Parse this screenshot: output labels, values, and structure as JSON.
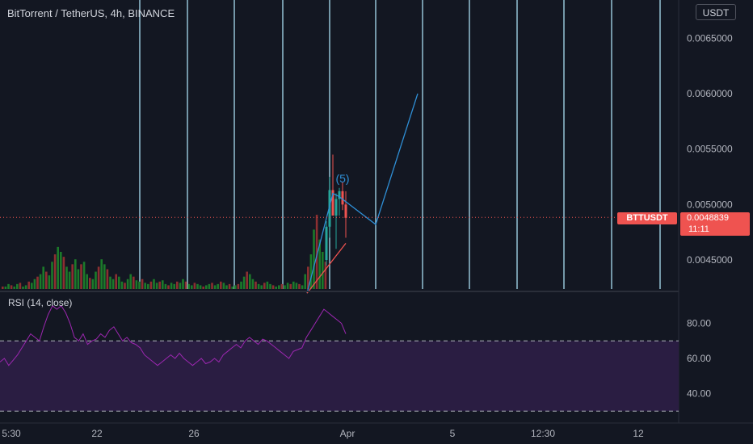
{
  "header": {
    "title": "BitTorrent / TetherUS, 4h, BINANCE",
    "currency": "USDT"
  },
  "price_label": {
    "symbol": "BTTUSDT",
    "price": "0.0048839",
    "countdown": "11:11"
  },
  "rsi": {
    "title": "RSI (14, close)"
  },
  "colors": {
    "background": "#131722",
    "up": "#26a69a",
    "down": "#ef5350",
    "volume_up": "#1b7a2a",
    "volume_down": "#8c2f31",
    "vline": "#a8dcf2",
    "projection": "#2f8fd6",
    "rsi_line": "#9c27b0",
    "rsi_band": "#2a1d42",
    "price_line": "#ef5350"
  },
  "chart_data": [
    {
      "type": "candlestick",
      "title": "BitTorrent / TetherUS, 4h, BINANCE",
      "ylim": [
        0.0042,
        0.0068
      ],
      "y_ticks": [
        "0.0045000",
        "0.0050000",
        "0.0055000",
        "0.0060000",
        "0.0065000"
      ],
      "x_ticks": [
        "5:30",
        "22",
        "26",
        "Apr",
        "5",
        "12:30",
        "12"
      ],
      "last_price": 0.0048839,
      "wave_label": "(5)",
      "candles": [
        {
          "x": 404,
          "open": 0.0045,
          "high": 0.00485,
          "low": 0.00445,
          "close": 0.0048
        },
        {
          "x": 408,
          "open": 0.0048,
          "high": 0.00525,
          "low": 0.0047,
          "close": 0.00513
        },
        {
          "x": 412,
          "open": 0.00513,
          "high": 0.00545,
          "low": 0.0049,
          "close": 0.0049
        },
        {
          "x": 416,
          "open": 0.0049,
          "high": 0.0051,
          "low": 0.0046,
          "close": 0.00505
        },
        {
          "x": 420,
          "open": 0.00505,
          "high": 0.00515,
          "low": 0.0049,
          "close": 0.00512
        },
        {
          "x": 424,
          "open": 0.00512,
          "high": 0.0052,
          "low": 0.00495,
          "close": 0.005
        },
        {
          "x": 428,
          "open": 0.005,
          "high": 0.00512,
          "low": 0.0047,
          "close": 0.00488
        }
      ],
      "projection": [
        [
          380,
          0.0042
        ],
        [
          412,
          0.0051
        ],
        [
          420,
          0.00507
        ],
        [
          465,
          0.00482
        ],
        [
          517,
          0.006
        ]
      ],
      "vertical_lines_x": [
        173,
        232,
        290,
        350,
        408,
        465,
        523,
        581,
        640,
        698,
        757,
        817
      ]
    },
    {
      "type": "bar",
      "title": "Volume",
      "values": [
        2,
        2,
        4,
        3,
        2,
        4,
        5,
        2,
        3,
        6,
        5,
        8,
        10,
        12,
        18,
        14,
        11,
        22,
        28,
        34,
        30,
        26,
        18,
        14,
        20,
        24,
        16,
        20,
        22,
        12,
        9,
        8,
        14,
        18,
        24,
        20,
        16,
        10,
        8,
        12,
        10,
        6,
        5,
        8,
        12,
        10,
        7,
        6,
        8,
        5,
        4,
        6,
        8,
        5,
        6,
        7,
        4,
        3,
        5,
        4,
        6,
        5,
        8,
        6,
        4,
        3,
        5,
        4,
        3,
        2,
        3,
        4,
        5,
        3,
        4,
        6,
        5,
        3,
        4,
        2,
        3,
        4,
        6,
        10,
        14,
        12,
        8,
        6,
        4,
        3,
        5,
        6,
        4,
        3,
        2,
        3,
        4,
        3,
        5,
        4,
        6,
        5,
        4,
        3,
        12,
        18,
        28,
        48,
        60,
        40,
        30,
        22
      ],
      "colors_up_down": "mixed"
    },
    {
      "type": "line",
      "title": "RSI (14, close)",
      "ylim": [
        30,
        95
      ],
      "y_ticks": [
        "40.00",
        "60.00",
        "80.00"
      ],
      "bands": [
        70,
        30
      ],
      "values": [
        58,
        60,
        56,
        59,
        62,
        66,
        70,
        74,
        72,
        70,
        78,
        85,
        90,
        88,
        90,
        86,
        80,
        72,
        70,
        74,
        68,
        70,
        71,
        74,
        72,
        76,
        78,
        74,
        70,
        72,
        69,
        68,
        66,
        62,
        60,
        58,
        56,
        58,
        60,
        62,
        60,
        63,
        60,
        58,
        56,
        58,
        60,
        57,
        58,
        60,
        58,
        62,
        64,
        66,
        68,
        66,
        70,
        72,
        70,
        68,
        71,
        70,
        68,
        66,
        64,
        62,
        60,
        64,
        65,
        66,
        72,
        76,
        80,
        84,
        88,
        86,
        84,
        82,
        80,
        74
      ]
    }
  ]
}
